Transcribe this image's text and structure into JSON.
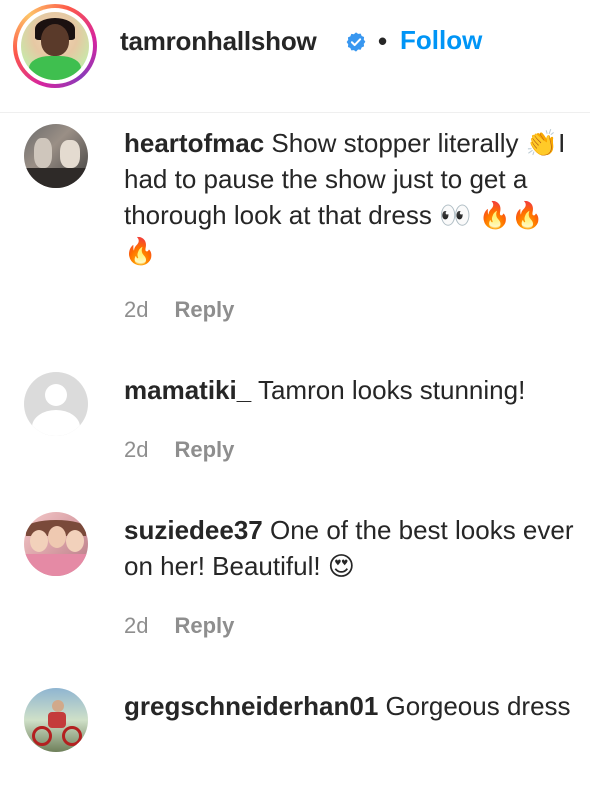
{
  "header": {
    "username": "tamronhallshow",
    "separator": "•",
    "follow_label": "Follow"
  },
  "comments": [
    {
      "username": "heartofmac",
      "text": "Show stopper literally 👏I had to pause the show just to get a thorough look at that dress 👀 🔥🔥🔥",
      "time": "2d",
      "reply_label": "Reply",
      "avatar": "photo-avatar"
    },
    {
      "username": "mamatiki_",
      "text": "Tamron looks stunning!",
      "time": "2d",
      "reply_label": "Reply",
      "avatar": "default-avatar"
    },
    {
      "username": "suziedee37",
      "text": "One of the best looks ever on her! Beautiful! 😍",
      "time": "2d",
      "reply_label": "Reply",
      "avatar": "photo-avatar"
    },
    {
      "username": "gregschneiderhan01",
      "text": "Gorgeous dress",
      "avatar": "photo-avatar"
    }
  ],
  "colors": {
    "accent": "#0095f6",
    "text": "#262626",
    "muted": "#8e8e8e",
    "verified": "#3897f0"
  },
  "icons": {
    "verified": "verified-badge-icon"
  }
}
